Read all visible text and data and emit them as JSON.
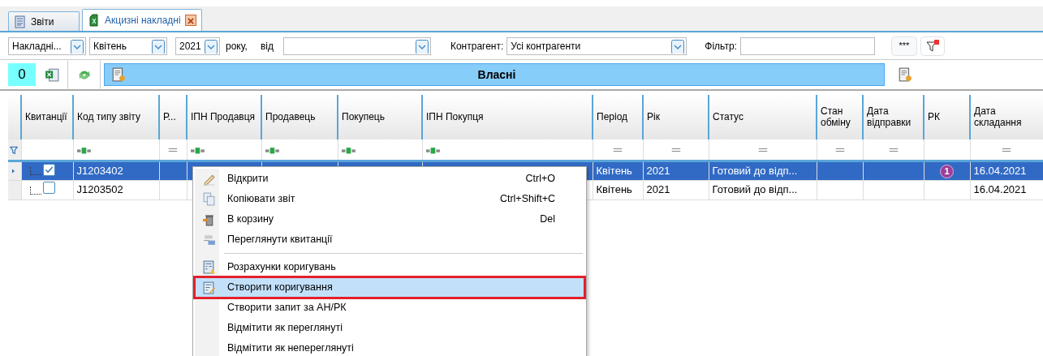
{
  "tabs": [
    {
      "label": "Звіти",
      "selected": false,
      "closable": false
    },
    {
      "label": "Акцизні накладні",
      "selected": true,
      "closable": true
    }
  ],
  "toolbar": {
    "type_select": "Накладні...",
    "month_select": "Квітень",
    "year_select": "2021",
    "year_suffix": "року,",
    "from_label": "від",
    "counterparty_label": "Контрагент:",
    "counterparty_select": "Усі контрагенти",
    "filter_label": "Фільтр:",
    "more_button": "***"
  },
  "counter": "0",
  "banner": "Власні",
  "table": {
    "columns": [
      {
        "label": "Квитанції",
        "kind": "plain"
      },
      {
        "label": "Код типу звіту",
        "kind": "text"
      },
      {
        "label": "Р...",
        "kind": "equals"
      },
      {
        "label": "ІПН Продавця",
        "kind": "text"
      },
      {
        "label": "Продавець",
        "kind": "text"
      },
      {
        "label": "Покупець",
        "kind": "text"
      },
      {
        "label": "ІПН Покупця",
        "kind": "text"
      },
      {
        "label": "Період",
        "kind": "equals"
      },
      {
        "label": "Рік",
        "kind": "equals"
      },
      {
        "label": "Статус",
        "kind": "equals"
      },
      {
        "label": "Стан обміну",
        "kind": "equals"
      },
      {
        "label": "Дата відправки",
        "kind": "equals"
      },
      {
        "label": "РК",
        "kind": "plain"
      },
      {
        "label": "Дата складання",
        "kind": "equals"
      }
    ],
    "rows": [
      {
        "selected": true,
        "checked": true,
        "code": "J1203402",
        "period": "Квітень",
        "year": "2021",
        "status": "Готовий до відп...",
        "rk_badge": "1",
        "date": "16.04.2021"
      },
      {
        "selected": false,
        "checked": false,
        "code": "J1203502",
        "period": "Квітень",
        "year": "2021",
        "status": "Готовий до відп...",
        "date": "16.04.2021"
      }
    ]
  },
  "context_menu": [
    {
      "label": "Відкрити",
      "shortcut": "Ctrl+O",
      "highlighted": false
    },
    {
      "label": "Копіювати звіт",
      "shortcut": "Ctrl+Shift+C",
      "highlighted": false
    },
    {
      "label": "В корзину",
      "shortcut": "Del",
      "highlighted": false
    },
    {
      "label": "Переглянути квитанції",
      "highlighted": false
    },
    {
      "label": "Розрахунки коригувань",
      "highlighted": false,
      "separator_before": true
    },
    {
      "label": "Створити коригування",
      "highlighted": true
    },
    {
      "label": "Створити запит за АН/РК",
      "highlighted": false
    },
    {
      "label": "Відмітити як переглянуті",
      "highlighted": false
    },
    {
      "label": "Відмітити як непереглянуті",
      "highlighted": false
    }
  ]
}
